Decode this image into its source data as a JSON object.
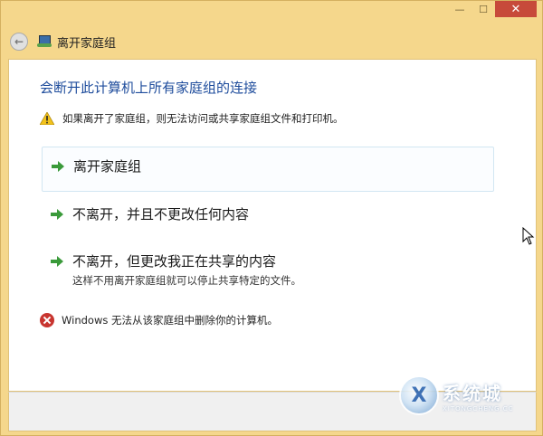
{
  "window": {
    "title": "离开家庭组",
    "minimize_glyph": "—",
    "maximize_glyph": "☐",
    "close_glyph": "✕"
  },
  "main": {
    "heading": "会断开此计算机上所有家庭组的连接",
    "warning_text": "如果离开了家庭组，则无法访问或共享家庭组文件和打印机。",
    "options": [
      {
        "label": "离开家庭组"
      },
      {
        "label": "不离开，并且不更改任何内容"
      },
      {
        "label": "不离开，但更改我正在共享的内容",
        "sublabel": "这样不用离开家庭组就可以停止共享特定的文件。"
      }
    ],
    "error_text": "Windows 无法从该家庭组中删除你的计算机。"
  },
  "watermark": {
    "logo_glyph": "X",
    "name": "系统城",
    "url": "XITONGCHENG.CC"
  },
  "colors": {
    "frame": "#f5d78c",
    "heading": "#1e4c9c",
    "close_button": "#c74a3a",
    "arrow": "#3a9a3a",
    "error": "#c8352f",
    "warning": "#f2c21b"
  },
  "icons": [
    "back-arrow-icon",
    "homegroup-icon",
    "warning-icon",
    "green-arrow-icon",
    "error-icon",
    "mouse-cursor-icon"
  ]
}
